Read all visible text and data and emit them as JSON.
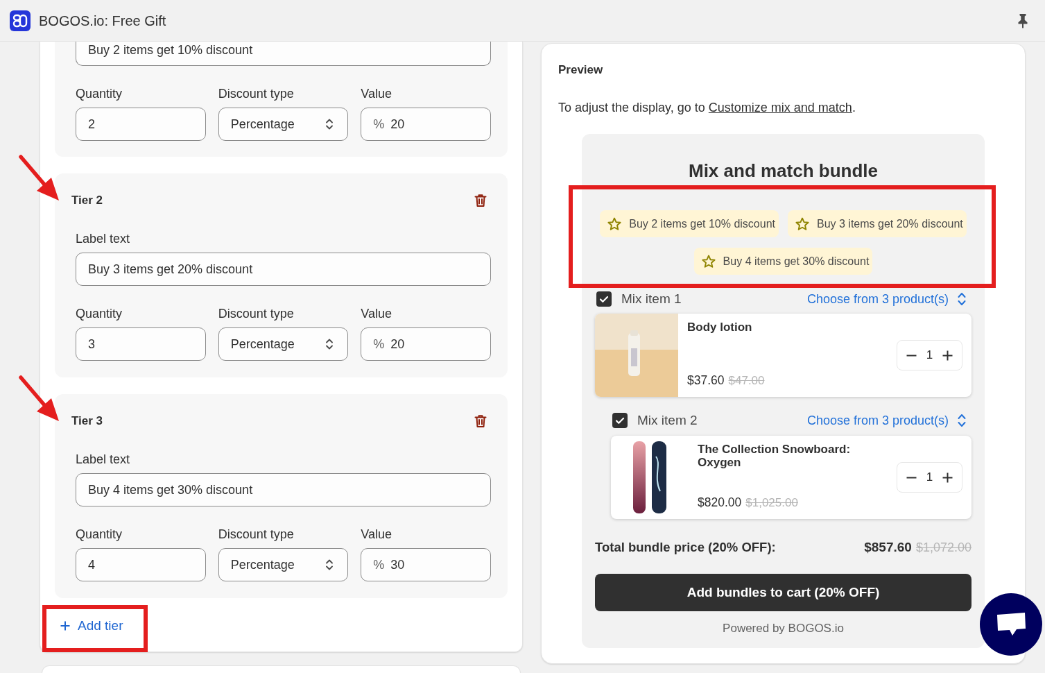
{
  "app_bar": {
    "title": "BOGOS.io: Free Gift"
  },
  "tiers_panel": {
    "tiers": [
      {
        "arrow_marker": false,
        "label_field": {
          "value": "Buy 2 items get 10% discount"
        },
        "quantity": {
          "label": "Quantity",
          "value": "2"
        },
        "discount_type": {
          "label": "Discount type",
          "value": "Percentage"
        },
        "discount_value": {
          "label": "Value",
          "prefix": "%",
          "value": "20"
        }
      },
      {
        "title": "Tier 2",
        "arrow_marker": true,
        "label_field": {
          "label": "Label text",
          "value": "Buy 3 items get 20% discount"
        },
        "quantity": {
          "label": "Quantity",
          "value": "3"
        },
        "discount_type": {
          "label": "Discount type",
          "value": "Percentage"
        },
        "discount_value": {
          "label": "Value",
          "prefix": "%",
          "value": "20"
        }
      },
      {
        "title": "Tier 3",
        "arrow_marker": true,
        "label_field": {
          "label": "Label text",
          "value": "Buy 4 items get 30% discount"
        },
        "quantity": {
          "label": "Quantity",
          "value": "4"
        },
        "discount_type": {
          "label": "Discount type",
          "value": "Percentage"
        },
        "discount_value": {
          "label": "Value",
          "prefix": "%",
          "value": "30"
        }
      }
    ],
    "add_tier": {
      "label": "Add tier",
      "highlighted": true
    }
  },
  "preview": {
    "title": "Preview",
    "hint": {
      "before": "To adjust the display, go to ",
      "link": "Customize mix and match",
      "after": "."
    },
    "bundle": {
      "title": "Mix and match bundle",
      "badges_highlighted": true,
      "offer_badges": [
        {
          "label": "Buy 2 items get 10% discount"
        },
        {
          "label": "Buy 3 items get 20% discount"
        },
        {
          "label": "Buy 4 items get 30% discount"
        }
      ],
      "mix_items": [
        {
          "label": "Mix item 1",
          "checked": true,
          "choose_link": "Choose from 3 product(s)",
          "product": {
            "kind": "bottle",
            "name": "Body lotion",
            "price": "$37.60",
            "compare_at_price": "$47.00",
            "quantity": "1"
          }
        },
        {
          "label": "Mix item 2",
          "checked": true,
          "choose_link": "Choose from 3 product(s)",
          "product": {
            "kind": "snowboard",
            "name": "The Collection Snowboard: Oxygen",
            "price": "$820.00",
            "compare_at_price": "$1,025.00",
            "quantity": "1"
          }
        }
      ],
      "total": {
        "label": "Total bundle price (20% OFF):",
        "price": "$857.60",
        "compare_at_price": "$1,072.00"
      },
      "add_button": "Add bundles to cart (20% OFF)",
      "footer": "Powered by BOGOS.io"
    }
  }
}
